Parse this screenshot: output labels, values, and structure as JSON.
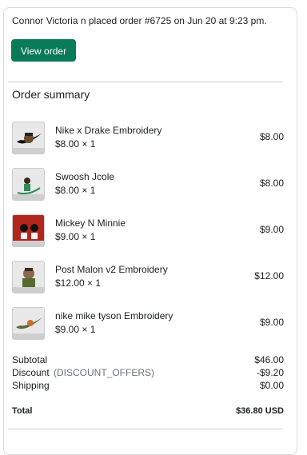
{
  "notification": {
    "message": "Connor Victoria n placed order #6725 on Jun 20 at 9:23 pm.",
    "button_label": "View order"
  },
  "summary": {
    "title": "Order summary",
    "items": [
      {
        "name": "Nike x Drake Embroidery",
        "qty": "$8.00 × 1",
        "price": "$8.00",
        "thumb_label": "Nike x Drake"
      },
      {
        "name": "Swoosh Jcole",
        "qty": "$8.00 × 1",
        "price": "$8.00",
        "thumb_label": "Swoosh Jcole"
      },
      {
        "name": "Mickey N Minnie",
        "qty": "$9.00 × 1",
        "price": "$9.00",
        "thumb_label": ""
      },
      {
        "name": "Post Malon v2 Embroidery",
        "qty": "$12.00 × 1",
        "price": "$12.00",
        "thumb_label": "Post Malone"
      },
      {
        "name": "nike mike tyson Embroidery",
        "qty": "$9.00 × 1",
        "price": "$9.00",
        "thumb_label": "Nike Mike Tyson"
      }
    ],
    "subtotal_label": "Subtotal",
    "subtotal_value": "$46.00",
    "discount_label": "Discount",
    "discount_code": "(DISCOUNT_OFFERS)",
    "discount_value": "-$9.20",
    "shipping_label": "Shipping",
    "shipping_value": "$0.00",
    "total_label": "Total",
    "total_value": "$36.80 USD"
  },
  "colors": {
    "button": "#0a7b57",
    "border": "#d9dadb",
    "muted": "#6d7175"
  }
}
